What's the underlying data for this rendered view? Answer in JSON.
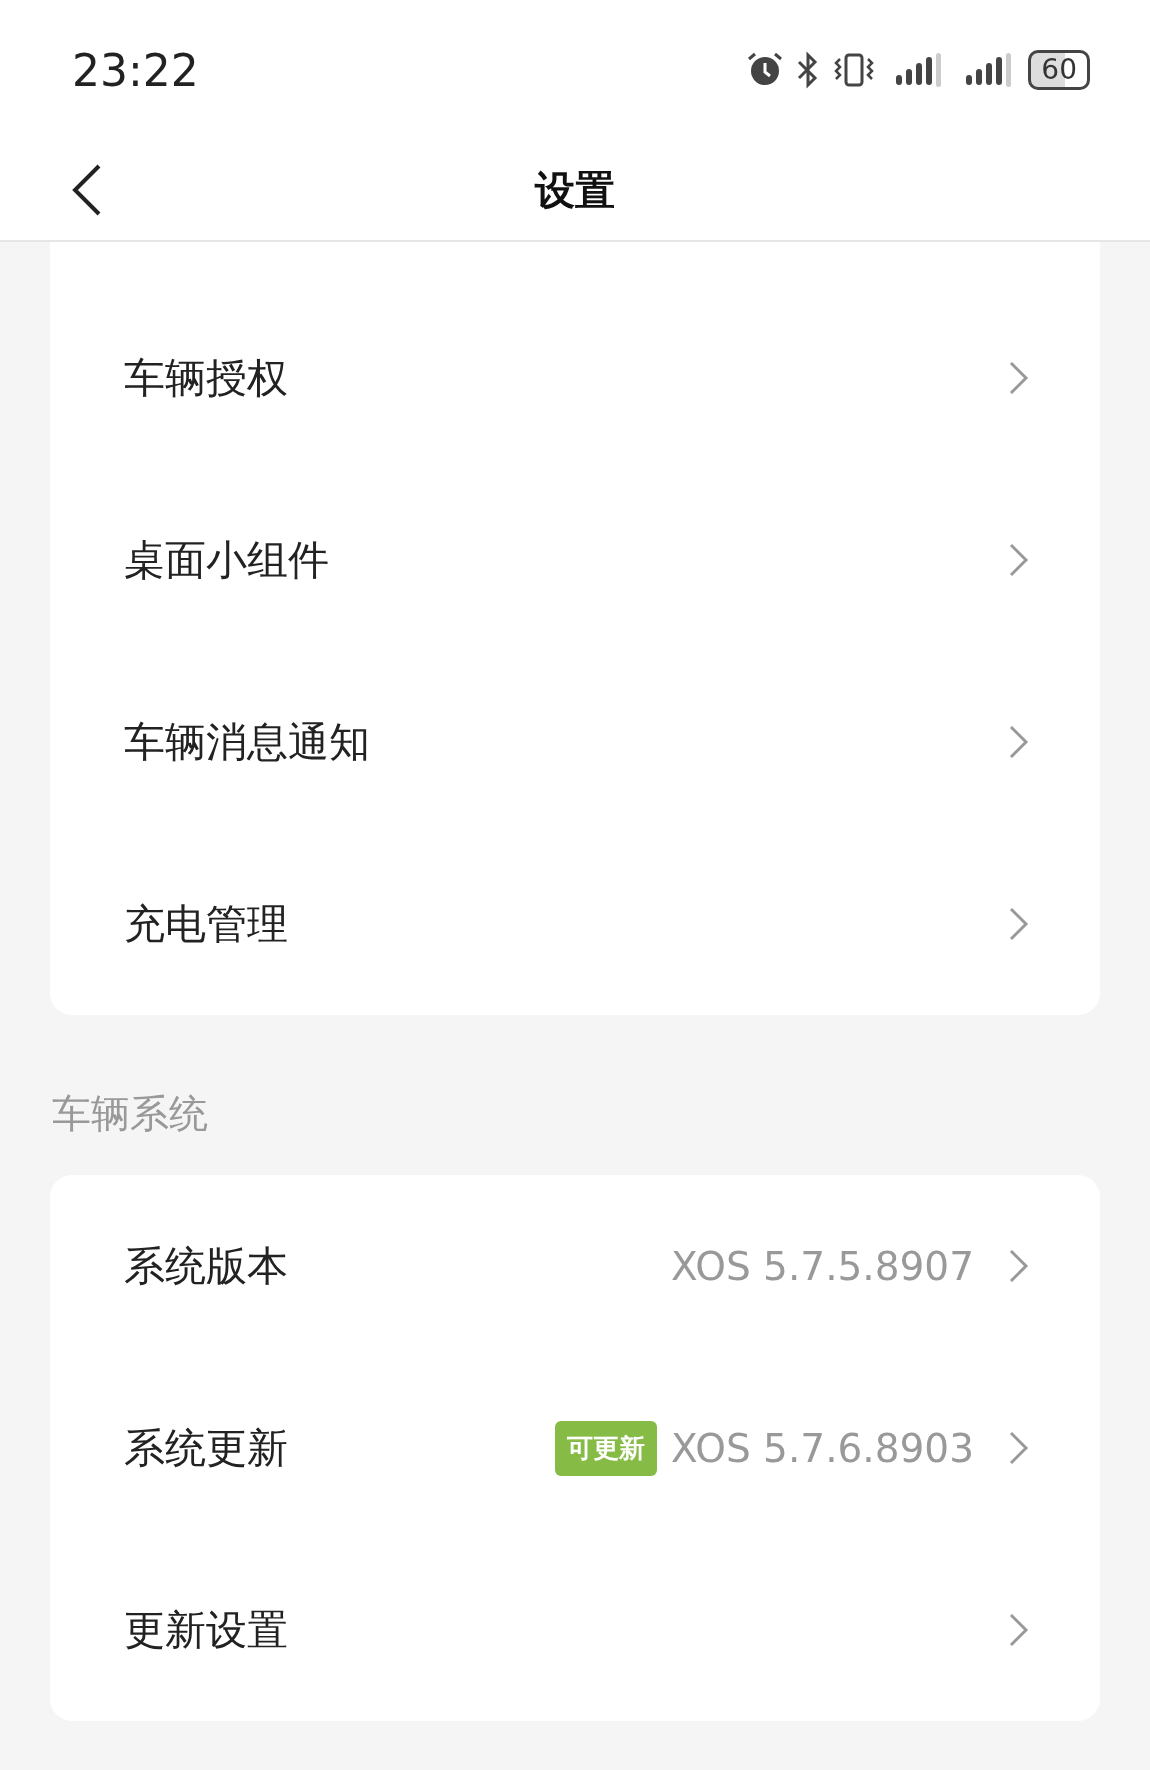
{
  "status_bar": {
    "time": "23:22",
    "battery": "60"
  },
  "header": {
    "title": "设置"
  },
  "sections": [
    {
      "items": [
        {
          "label": "车辆授权"
        },
        {
          "label": "桌面小组件"
        },
        {
          "label": "车辆消息通知"
        },
        {
          "label": "充电管理"
        }
      ]
    },
    {
      "title": "车辆系统",
      "items": [
        {
          "label": "系统版本",
          "value": "XOS 5.7.5.8907"
        },
        {
          "label": "系统更新",
          "badge": "可更新",
          "value": "XOS 5.7.6.8903"
        },
        {
          "label": "更新设置"
        }
      ]
    }
  ]
}
